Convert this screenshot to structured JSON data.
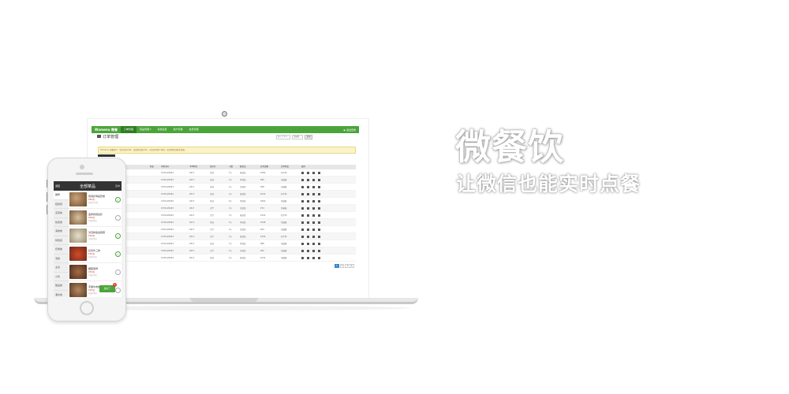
{
  "headline": "微餐饮",
  "subline": "让微信也能实时点餐",
  "laptop": {
    "nav": {
      "logo": "Wxmenu 微餐",
      "items": [
        "订单管理",
        "菜品管理 ▾",
        "系统设置",
        "用户管理",
        "会员管理"
      ],
      "right": "▶  退出登录"
    },
    "page_title": "订单管理",
    "search": {
      "placeholder": "输入订单号",
      "select": "请选择",
      "button": "查询"
    },
    "notice": "Wxmenu 温馨提示：您有新的订单，请及时处理订单，以免影响用户体验，如需帮助请联系客服。",
    "table": {
      "headers": [
        "订单号",
        "状态",
        "手机号码",
        "下单时间",
        "桌台号",
        "人数",
        "服务员",
        "应付金额",
        "订单状态",
        "操作"
      ],
      "rows": [
        [
          "",
          "",
          "1532129993",
          "2017",
          "包间",
          "5人",
          "张某某",
          "¥180",
          "已下单",
          ""
        ],
        [
          "",
          "",
          "1532129993",
          "2017",
          "包间",
          "3人",
          "李某某",
          "¥96",
          "已结账",
          ""
        ],
        [
          "",
          "",
          "1532129993",
          "2017",
          "包间",
          "2人",
          "王某某",
          "¥58",
          "已结账",
          ""
        ],
        [
          "",
          "",
          "1532129993",
          "2017",
          "包间",
          "4人",
          "张某某",
          "¥142",
          "已下单",
          ""
        ],
        [
          "",
          "",
          "1532129993",
          "2017",
          "包间",
          "6人",
          "李某某",
          "¥260",
          "已结账",
          ""
        ],
        [
          "",
          "",
          "1532129993",
          "2017",
          "大厅",
          "2人",
          "王某某",
          "¥74",
          "已结账",
          ""
        ],
        [
          "",
          "",
          "1532129993",
          "2017",
          "大厅",
          "3人",
          "张某某",
          "¥120",
          "已下单",
          ""
        ],
        [
          "",
          "",
          "1532129993",
          "2017",
          "包间",
          "5人",
          "李某某",
          "¥198",
          "已结账",
          ""
        ],
        [
          "",
          "",
          "1532129993",
          "2017",
          "大厅",
          "2人",
          "王某某",
          "¥64",
          "已结账",
          ""
        ],
        [
          "",
          "",
          "1532129993",
          "2017",
          "大厅",
          "4人",
          "张某某",
          "¥156",
          "已下单",
          ""
        ],
        [
          "",
          "",
          "1532129993",
          "2017",
          "包间",
          "3人",
          "李某某",
          "¥88",
          "已结账",
          ""
        ],
        [
          "",
          "",
          "1532129993",
          "2017",
          "大厅",
          "2人",
          "王某某",
          "¥52",
          "已结账",
          ""
        ],
        [
          "",
          "",
          "1532129993",
          "2017",
          "包间",
          "4人",
          "张某某",
          "¥134",
          "已结账",
          ""
        ]
      ]
    },
    "pager": [
      "1",
      "2",
      "下一页"
    ]
  },
  "phone": {
    "title": "全部菜品",
    "back": "返回",
    "menu": "菜单",
    "categories": [
      "推荐",
      "招牌菜",
      "凉菜类",
      "热菜类",
      "海鲜类",
      "特色菜",
      "烧烤类",
      "汤类",
      "主食",
      "小吃",
      "甜品类",
      "酒水类"
    ],
    "items": [
      {
        "name": "香辣虾烤鱼套餐",
        "price": "¥88/份",
        "sales": "已售112份",
        "checked": true
      },
      {
        "name": "金牌香辣龙虾",
        "price": "¥98/份",
        "sales": "已售85份",
        "checked": false
      },
      {
        "name": "清蒸鲈鱼加蒜蓉",
        "price": "¥68/份",
        "sales": "已售64份",
        "checked": true
      },
      {
        "name": "红烧牛三鲜",
        "price": "¥58/份",
        "sales": "已售52份",
        "checked": true
      },
      {
        "name": "糖醋里脊",
        "price": "¥38/份",
        "sales": "已售41份",
        "checked": false
      },
      {
        "name": "手撕牛肉饭",
        "price": "¥28/份",
        "sales": "已售36份",
        "checked": false
      }
    ],
    "order_button": "选好了",
    "badge": "4"
  },
  "colors": {
    "brand_green": "#4aa43a",
    "dark": "#333333",
    "price_red": "#e23b3b"
  }
}
